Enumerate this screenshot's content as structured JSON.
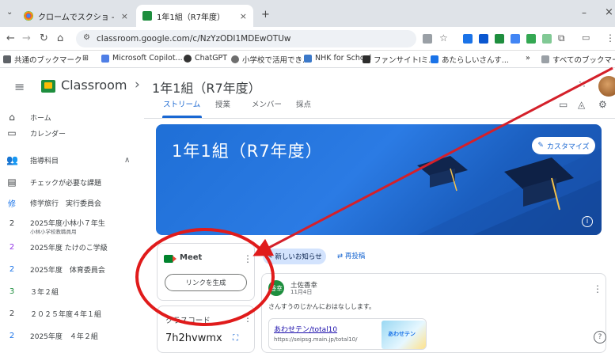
{
  "browser": {
    "tabs": [
      {
        "label": "クロームでスクショ - Googl",
        "close": "×"
      },
      {
        "label": "1年1組（R7年度）",
        "close": "×"
      }
    ],
    "new_tab": "+",
    "window_controls": {
      "minimize": "–",
      "close": "×"
    },
    "url": "classroom.google.com/c/NzYzODI1MDEwOTUw",
    "bookmarks": [
      {
        "label": "共通のブックマーク",
        "color": "#5f6368"
      },
      {
        "label": "Microsoft Copilot...",
        "color": "#4f7fe6"
      },
      {
        "label": "ChatGPT",
        "color": "#333333"
      },
      {
        "label": "小学校で活用でき...",
        "color": "#6e6e6e"
      },
      {
        "label": "NHK for School",
        "color": "#3c79c9"
      },
      {
        "label": "ファンサイトⅠミ...",
        "color": "#2d2d2d"
      },
      {
        "label": "あたらしいさんす...",
        "color": "#1a73e8"
      }
    ],
    "all_bookmarks": "すべてのブックマーク"
  },
  "header": {
    "app_name": "Classroom",
    "separator": "›",
    "class_name": "1年1組（R7年度）"
  },
  "sidebar": {
    "home": "ホーム",
    "calendar": "カレンダー",
    "enrolled_heading": "指導科目",
    "todo": "チェックが必要な課題",
    "classes": [
      {
        "badge": "修",
        "label": "修学旅行　実行委員会",
        "sub": "",
        "color": "#1a73e8",
        "badge_type": "text"
      },
      {
        "badge": "2",
        "label": "2025年度小林小７年生",
        "sub": "小林小学校教職員用",
        "color": "#5f6368",
        "badge_type": "plain"
      },
      {
        "badge": "2",
        "label": "2025年度 たけのこ学級",
        "sub": "",
        "color": "#9334e6",
        "badge_type": "plain"
      },
      {
        "badge": "2",
        "label": "2025年度　体育委員会",
        "sub": "",
        "color": "#1a73e8",
        "badge_type": "plain"
      },
      {
        "badge": "3",
        "label": "３年２組",
        "sub": "",
        "color": "#1e8e3e",
        "badge_type": "plain"
      },
      {
        "badge": "2",
        "label": "２０２５年度４年１組",
        "sub": "",
        "color": "#5f6368",
        "badge_type": "plain"
      },
      {
        "badge": "2",
        "label": "2025年度　４年２組",
        "sub": "",
        "color": "#1a73e8",
        "badge_type": "plain"
      }
    ]
  },
  "tabs": {
    "stream": "ストリーム",
    "classwork": "授業",
    "people": "メンバー",
    "grades": "採点"
  },
  "banner": {
    "title": "1年1組（R7年度）",
    "customize": "カスタマイズ"
  },
  "meet": {
    "label": "Meet",
    "generate_link": "リンクを生成"
  },
  "class_code": {
    "label": "クラスコード",
    "value": "7h2hvwmx"
  },
  "composer": {
    "new_announcement": "新しいお知らせ",
    "repost": "再投稿"
  },
  "post": {
    "avatar_text": "香幸",
    "author": "土佐香幸",
    "date": "11月4日",
    "body": "さんすうのじかんにおはなしします。",
    "link_title": "あわせテン/total10",
    "link_url": "https://seipsg.main.jp/total10/",
    "thumb_text": "あわせテン"
  },
  "colors": {
    "accent": "#1967d2",
    "annotation": "#e01b1b",
    "banner": "#1f6fd6"
  }
}
